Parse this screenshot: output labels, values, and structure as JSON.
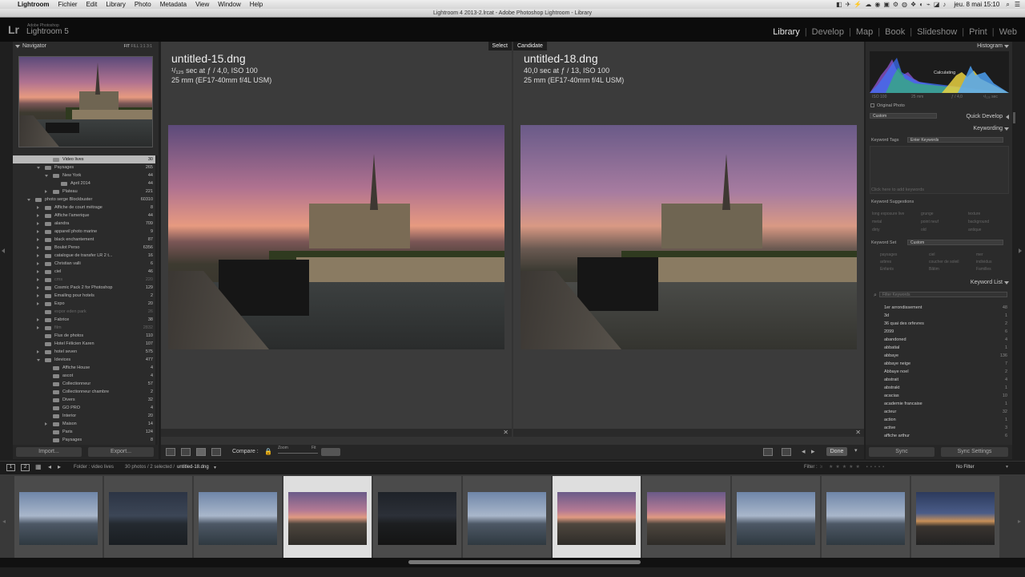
{
  "menubar": {
    "app": "Lightroom",
    "items": [
      "Fichier",
      "Edit",
      "Library",
      "Photo",
      "Metadata",
      "View",
      "Window",
      "Help"
    ],
    "clock": "jeu. 8 mai  15:10"
  },
  "window": {
    "title": "Lightroom 4 2013-2.lrcat - Adobe Photoshop Lightroom - Library"
  },
  "identity": {
    "logo": "Lr",
    "subtitle": "Adobe Photoshop",
    "product": "Lightroom 5"
  },
  "modules": [
    "Library",
    "Develop",
    "Map",
    "Book",
    "Slideshow",
    "Print",
    "Web"
  ],
  "active_module": "Library",
  "navigator": {
    "title": "Navigator",
    "zoom_options": [
      "FIT",
      "FILL",
      "1:1",
      "3:1"
    ]
  },
  "folders": [
    {
      "name": "Video lives",
      "count": "30",
      "level": 3,
      "state": "none",
      "dim": false,
      "selected": true
    },
    {
      "name": "Paysages",
      "count": "265",
      "level": 2,
      "state": "open",
      "dim": false
    },
    {
      "name": "New York",
      "count": "44",
      "level": 3,
      "state": "open",
      "dim": false
    },
    {
      "name": "April 2014",
      "count": "44",
      "level": 4,
      "state": "none",
      "dim": false
    },
    {
      "name": "Plateau",
      "count": "221",
      "level": 3,
      "state": "closed",
      "dim": false
    },
    {
      "name": "photo serge Blockbuster",
      "count": "60310",
      "level": 1,
      "state": "open",
      "dim": false
    },
    {
      "name": "Affiche de court métrage",
      "count": "8",
      "level": 2,
      "state": "closed",
      "dim": false
    },
    {
      "name": "Affiche l'amerique",
      "count": "44",
      "level": 2,
      "state": "closed",
      "dim": false
    },
    {
      "name": "alandra",
      "count": "709",
      "level": 2,
      "state": "closed",
      "dim": false
    },
    {
      "name": "appareil photo marine",
      "count": "9",
      "level": 2,
      "state": "closed",
      "dim": false
    },
    {
      "name": "black enchantement",
      "count": "87",
      "level": 2,
      "state": "closed",
      "dim": false
    },
    {
      "name": "Boulot Perso",
      "count": "6356",
      "level": 2,
      "state": "closed",
      "dim": false
    },
    {
      "name": "catalogue de transfer LR 2 t...",
      "count": "16",
      "level": 2,
      "state": "closed",
      "dim": false
    },
    {
      "name": "Christian valli",
      "count": "6",
      "level": 2,
      "state": "closed",
      "dim": false
    },
    {
      "name": "ciel",
      "count": "46",
      "level": 2,
      "state": "closed",
      "dim": false
    },
    {
      "name": "cms",
      "count": "220",
      "level": 2,
      "state": "closed",
      "dim": true
    },
    {
      "name": "Cosmic Pack 2 for Photoshop",
      "count": "129",
      "level": 2,
      "state": "closed",
      "dim": false
    },
    {
      "name": "Emailing pour hotels",
      "count": "2",
      "level": 2,
      "state": "closed",
      "dim": false
    },
    {
      "name": "Expo",
      "count": "20",
      "level": 2,
      "state": "closed",
      "dim": false
    },
    {
      "name": "expor eden park",
      "count": "26",
      "level": 2,
      "state": "none",
      "dim": true
    },
    {
      "name": "Fabrice",
      "count": "38",
      "level": 2,
      "state": "closed",
      "dim": false
    },
    {
      "name": "film",
      "count": "2832",
      "level": 2,
      "state": "closed",
      "dim": true
    },
    {
      "name": "Flux de photos",
      "count": "110",
      "level": 2,
      "state": "none",
      "dim": false
    },
    {
      "name": "Hotel Félicien Karen",
      "count": "107",
      "level": 2,
      "state": "none",
      "dim": false
    },
    {
      "name": "hotel seven",
      "count": "575",
      "level": 2,
      "state": "closed",
      "dim": false
    },
    {
      "name": "Idevices",
      "count": "477",
      "level": 2,
      "state": "open",
      "dim": false
    },
    {
      "name": "Affiche House",
      "count": "4",
      "level": 3,
      "state": "none",
      "dim": false
    },
    {
      "name": "ascot",
      "count": "4",
      "level": 3,
      "state": "none",
      "dim": false
    },
    {
      "name": "Collectionneur",
      "count": "57",
      "level": 3,
      "state": "none",
      "dim": false
    },
    {
      "name": "Collectionneur chambre",
      "count": "2",
      "level": 3,
      "state": "none",
      "dim": false
    },
    {
      "name": "Divers",
      "count": "32",
      "level": 3,
      "state": "none",
      "dim": false
    },
    {
      "name": "GO PRO",
      "count": "4",
      "level": 3,
      "state": "none",
      "dim": false
    },
    {
      "name": "Interior",
      "count": "20",
      "level": 3,
      "state": "none",
      "dim": false
    },
    {
      "name": "Maison",
      "count": "14",
      "level": 3,
      "state": "closed",
      "dim": false
    },
    {
      "name": "Paris",
      "count": "124",
      "level": 3,
      "state": "none",
      "dim": false
    },
    {
      "name": "Paysages",
      "count": "8",
      "level": 3,
      "state": "none",
      "dim": false
    }
  ],
  "left_buttons": {
    "import": "Import...",
    "export": "Export..."
  },
  "compare": {
    "select_tag": "Select",
    "candidate_tag": "Candidate",
    "left": {
      "filename": "untitled-15.dng",
      "exposure": "¹/₁₂₅ sec at ƒ / 4,0, ISO 100",
      "lens": "25 mm (EF17-40mm f/4L USM)"
    },
    "right": {
      "filename": "untitled-18.dng",
      "exposure": "40,0 sec at ƒ / 13, ISO 100",
      "lens": "25 mm (EF17-40mm f/4L USM)"
    }
  },
  "toolbar": {
    "compare_label": "Compare :",
    "zoom_label": "Zoom",
    "fit_label": "Fit",
    "done": "Done"
  },
  "histogram": {
    "title": "Histogram",
    "calculating": "Calculating",
    "readout": [
      "ISO 100",
      "25 mm",
      "ƒ / 4,0",
      "¹/₁₂₅ sec"
    ],
    "original_photo": "Original Photo"
  },
  "quick_develop": {
    "title": "Quick Develop",
    "preset": "Custom"
  },
  "keywording": {
    "title": "Keywording",
    "tags_label": "Keyword Tags",
    "tags_placeholder": "Enter Keywords",
    "add_hint": "Click here to add keywords",
    "suggestions_label": "Keyword Suggestions",
    "suggestions": [
      "long exposure live",
      "grunge",
      "texture",
      "metal",
      "point neuf",
      "background",
      "dirty",
      "old",
      "antique"
    ],
    "set_label": "Keyword Set",
    "set_value": "Custom",
    "set_items": [
      "paysages",
      "ciel",
      "mer",
      "arbres",
      "coucher de soleil",
      "individus",
      "Enfants",
      "Bâtim",
      "Familles"
    ]
  },
  "keyword_list": {
    "title": "Keyword List",
    "filter_placeholder": "Filter Keywords",
    "items": [
      {
        "name": "1er arrondissement",
        "count": "48"
      },
      {
        "name": "3d",
        "count": "1"
      },
      {
        "name": "36 quai des orfevres",
        "count": "2"
      },
      {
        "name": "2099",
        "count": "6"
      },
      {
        "name": "abandoned",
        "count": "4"
      },
      {
        "name": "abbatial",
        "count": "1"
      },
      {
        "name": "abbaye",
        "count": "136"
      },
      {
        "name": "abbaye neige",
        "count": "7"
      },
      {
        "name": "Abbaye noel",
        "count": "2"
      },
      {
        "name": "abstrait",
        "count": "4"
      },
      {
        "name": "abstrakt",
        "count": "1"
      },
      {
        "name": "acacias",
        "count": "10"
      },
      {
        "name": "academie francaise",
        "count": "1"
      },
      {
        "name": "acteur",
        "count": "32"
      },
      {
        "name": "action",
        "count": "1"
      },
      {
        "name": "active",
        "count": "3"
      },
      {
        "name": "affiche arthur",
        "count": "6"
      }
    ]
  },
  "right_buttons": {
    "sync": "Sync",
    "sync_settings": "Sync Settings"
  },
  "filmbar": {
    "source": "Folder : video lives",
    "count": "30 photos / 2 selected /",
    "file": "untitled-18.dng",
    "filter_label": "Filter :",
    "filter_value": "No Filter"
  },
  "filmstrip": [
    {
      "tone": "blue",
      "selected": false
    },
    {
      "tone": "dark",
      "selected": false
    },
    {
      "tone": "blue",
      "selected": false
    },
    {
      "tone": "sunset",
      "selected": true
    },
    {
      "tone": "night",
      "selected": false
    },
    {
      "tone": "blue",
      "selected": false
    },
    {
      "tone": "sunset",
      "selected": true
    },
    {
      "tone": "sunset",
      "selected": false
    },
    {
      "tone": "blue",
      "selected": false
    },
    {
      "tone": "blue",
      "selected": false
    },
    {
      "tone": "lit",
      "selected": false
    }
  ]
}
